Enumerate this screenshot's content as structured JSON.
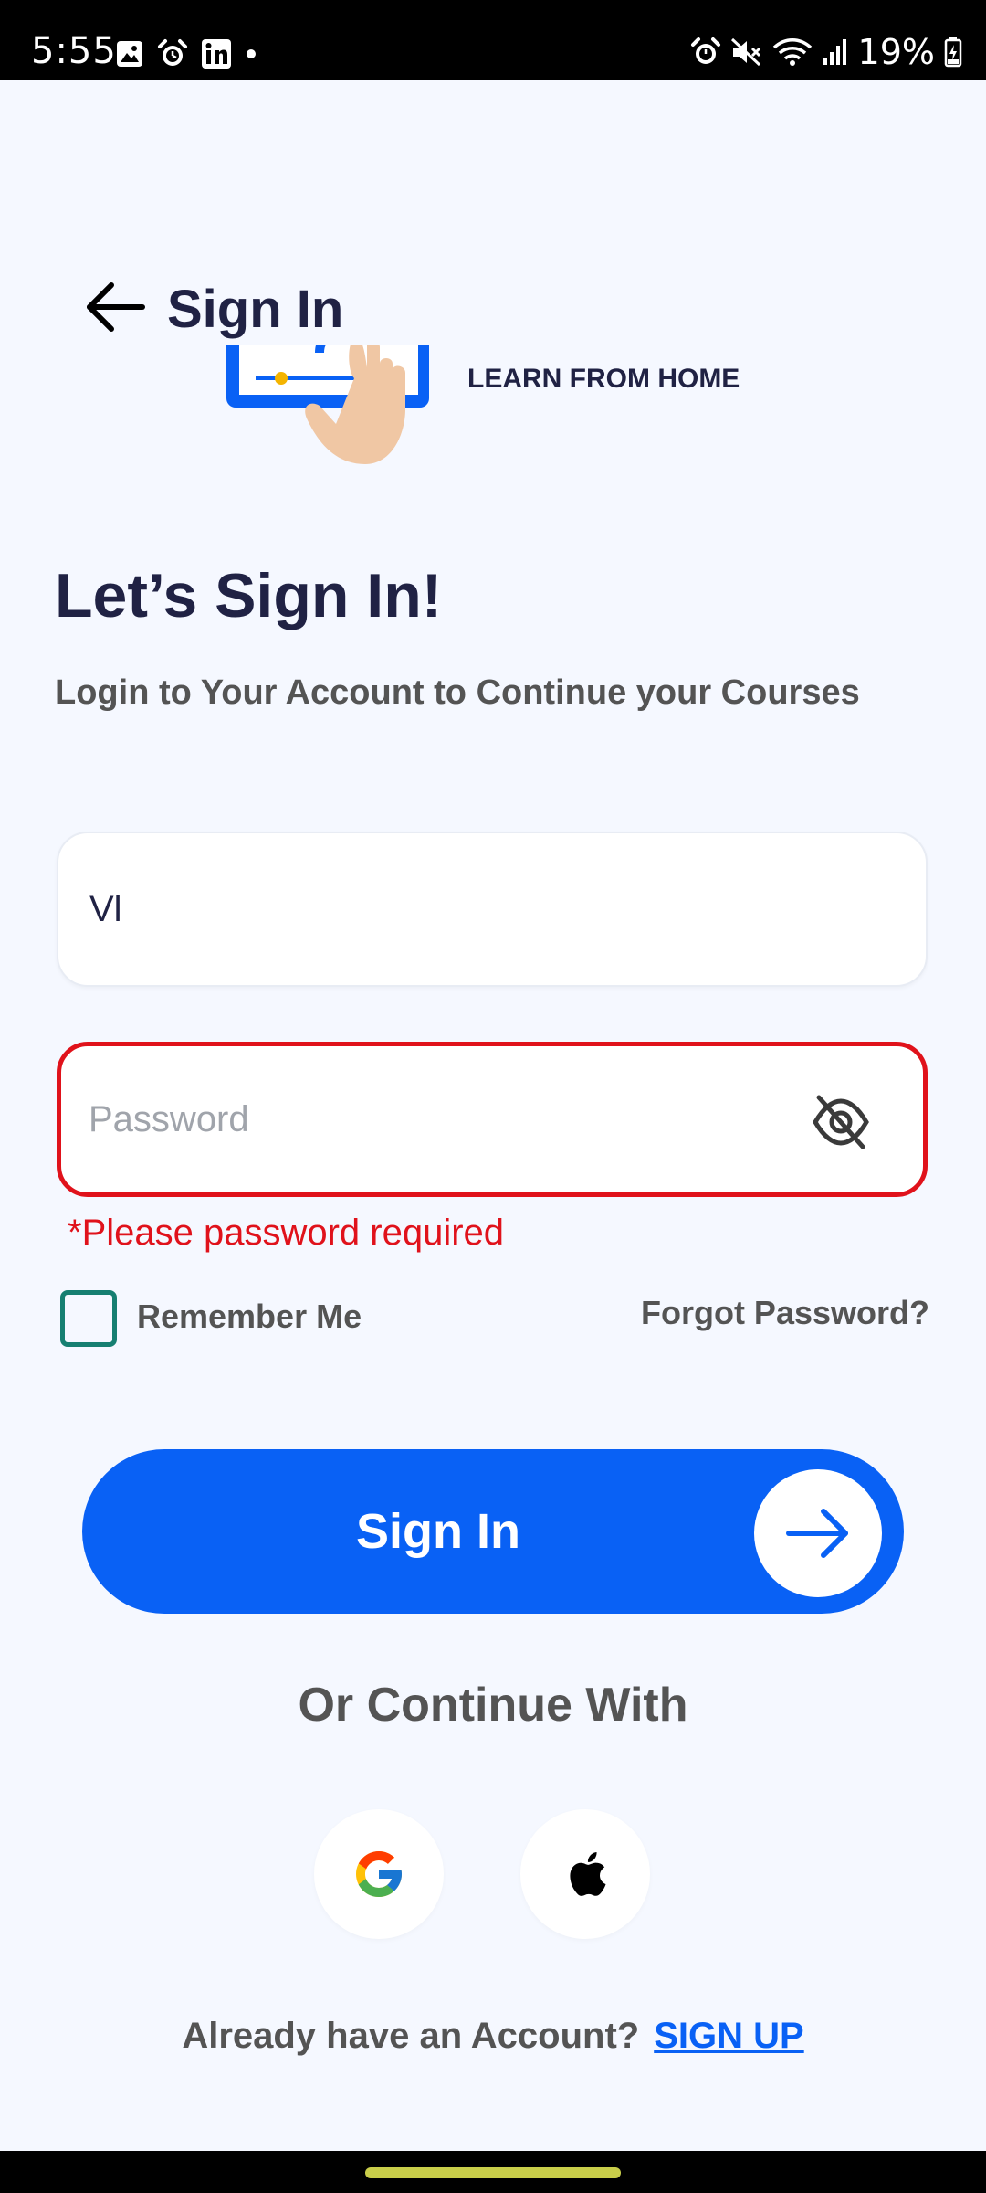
{
  "status_bar": {
    "time": "5:55",
    "battery_percent": "19%",
    "left_icons": [
      "gallery-icon",
      "alarm-icon",
      "linkedin-icon",
      "dot-icon"
    ],
    "right_icons": [
      "alarm-icon",
      "mute-icon",
      "wifi-icon",
      "signal-icon",
      "battery-icon"
    ]
  },
  "header": {
    "title": "Sign In",
    "back_icon": "arrow-left-icon"
  },
  "illustration": {
    "caption": "LEARN FROM HOME"
  },
  "main": {
    "heading": "Let’s Sign In!",
    "subheading": "Login to Your Account to Continue your Courses"
  },
  "form": {
    "email_value": "Vl",
    "password_value": "",
    "password_placeholder": "Password",
    "password_error": "*Please password required",
    "remember_label": "Remember Me",
    "remember_checked": false,
    "forgot_label": "Forgot Password?",
    "visibility_icon": "eye-off-icon"
  },
  "actions": {
    "signin_label": "Sign In",
    "or_continue": "Or Continue With"
  },
  "social": [
    {
      "name": "google",
      "icon": "google-icon"
    },
    {
      "name": "apple",
      "icon": "apple-icon"
    }
  ],
  "footer": {
    "text": "Already have an Account?",
    "link": "SIGN UP"
  },
  "colors": {
    "background": "#F5F8FF",
    "primary": "#0961F5",
    "error": "#E0121B",
    "checkbox": "#167F71",
    "heading": "#202244",
    "muted": "#545454"
  }
}
